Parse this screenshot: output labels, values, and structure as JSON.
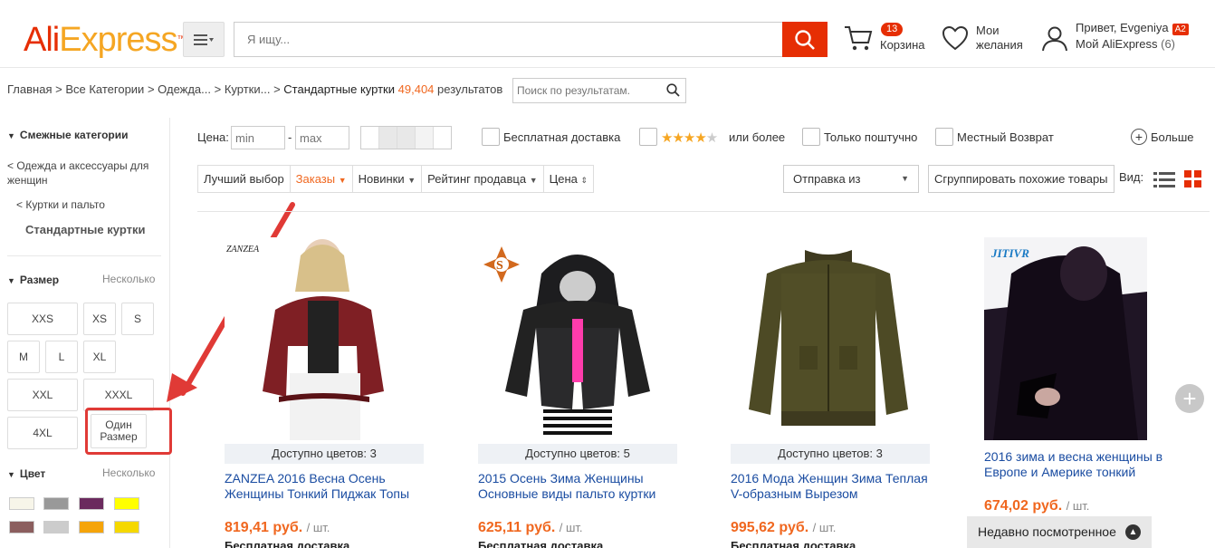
{
  "header": {
    "logo_part1": "Ali",
    "logo_part2": "Express",
    "logo_tm": "™",
    "search_placeholder": "Я ищу...",
    "cart_count": "13",
    "cart_label": "Корзина",
    "wish_line1": "Мои",
    "wish_line2": "желания",
    "greeting": "Привет, Evgeniya",
    "level_badge": "A2",
    "my_ali": "Мой AliExpress",
    "my_ali_count": "(6)"
  },
  "breadcrumb": {
    "items": [
      "Главная",
      "Все Категории",
      "Одежда...",
      "Куртки..."
    ],
    "current": "Стандартные куртки",
    "count": "49,404",
    "results_word": "результатов",
    "search_placeholder": "Поиск по результатам."
  },
  "sidebar": {
    "related_title": "Смежные категории",
    "link1": "< Одежда и аксессуары для женщин",
    "link2": "< Куртки и пальто",
    "current_cat": "Стандартные куртки",
    "size_title": "Размер",
    "size_more": "Несколько",
    "sizes": [
      "XXS",
      "XS",
      "S",
      "M",
      "L",
      "XL",
      "XXL",
      "XXXL",
      "4XL",
      "Один Размер"
    ],
    "color_title": "Цвет",
    "color_more": "Несколько",
    "colors": [
      "#f7f5e9",
      "#999999",
      "#6b2a5e",
      "#ffff00",
      "#8b5e5e",
      "#cccccc",
      "#f5a40a",
      "#f5d800"
    ]
  },
  "filters": {
    "price_label": "Цена:",
    "price_min": "min",
    "price_sep": "-",
    "price_max": "max",
    "free_shipping": "Бесплатная доставка",
    "rating_suffix": "или более",
    "single_item": "Только поштучно",
    "local_return": "Местный Возврат",
    "more": "Больше"
  },
  "sort": {
    "best": "Лучший выбор",
    "orders": "Заказы",
    "new": "Новинки",
    "seller_rating": "Рейтинг продавца",
    "price": "Цена",
    "ship_from": "Отправка из",
    "group_similar": "Сгруппировать похожие товары",
    "view_label": "Вид:"
  },
  "products": [
    {
      "avail": "Доступно цветов: 3",
      "title": "ZANZEA 2016 Весна Осень Женщины Тонкий Пиджак Топы",
      "price": "819,41 руб.",
      "unit": "/ шт.",
      "shipping": "Бесплатная доставка",
      "brand": "ZANZEA"
    },
    {
      "avail": "Доступно цветов: 5",
      "title": "2015 Осень Зима Женщины Основные виды пальто куртки",
      "price": "625,11 руб.",
      "unit": "/ шт.",
      "shipping": "Бесплатная доставка"
    },
    {
      "avail": "Доступно цветов: 3",
      "title": "2016 Мода Женщин Зима Теплая V-образным Вырезом",
      "price": "995,62 руб.",
      "unit": "/ шт.",
      "shipping": "Бесплатная доставка"
    },
    {
      "title": "2016 зима и весна женщины в Европе и Америке тонкий",
      "price": "674,02 руб.",
      "unit": "/ шт.",
      "brand": "JITIVR"
    }
  ],
  "recent": "Недавно посмотренное"
}
